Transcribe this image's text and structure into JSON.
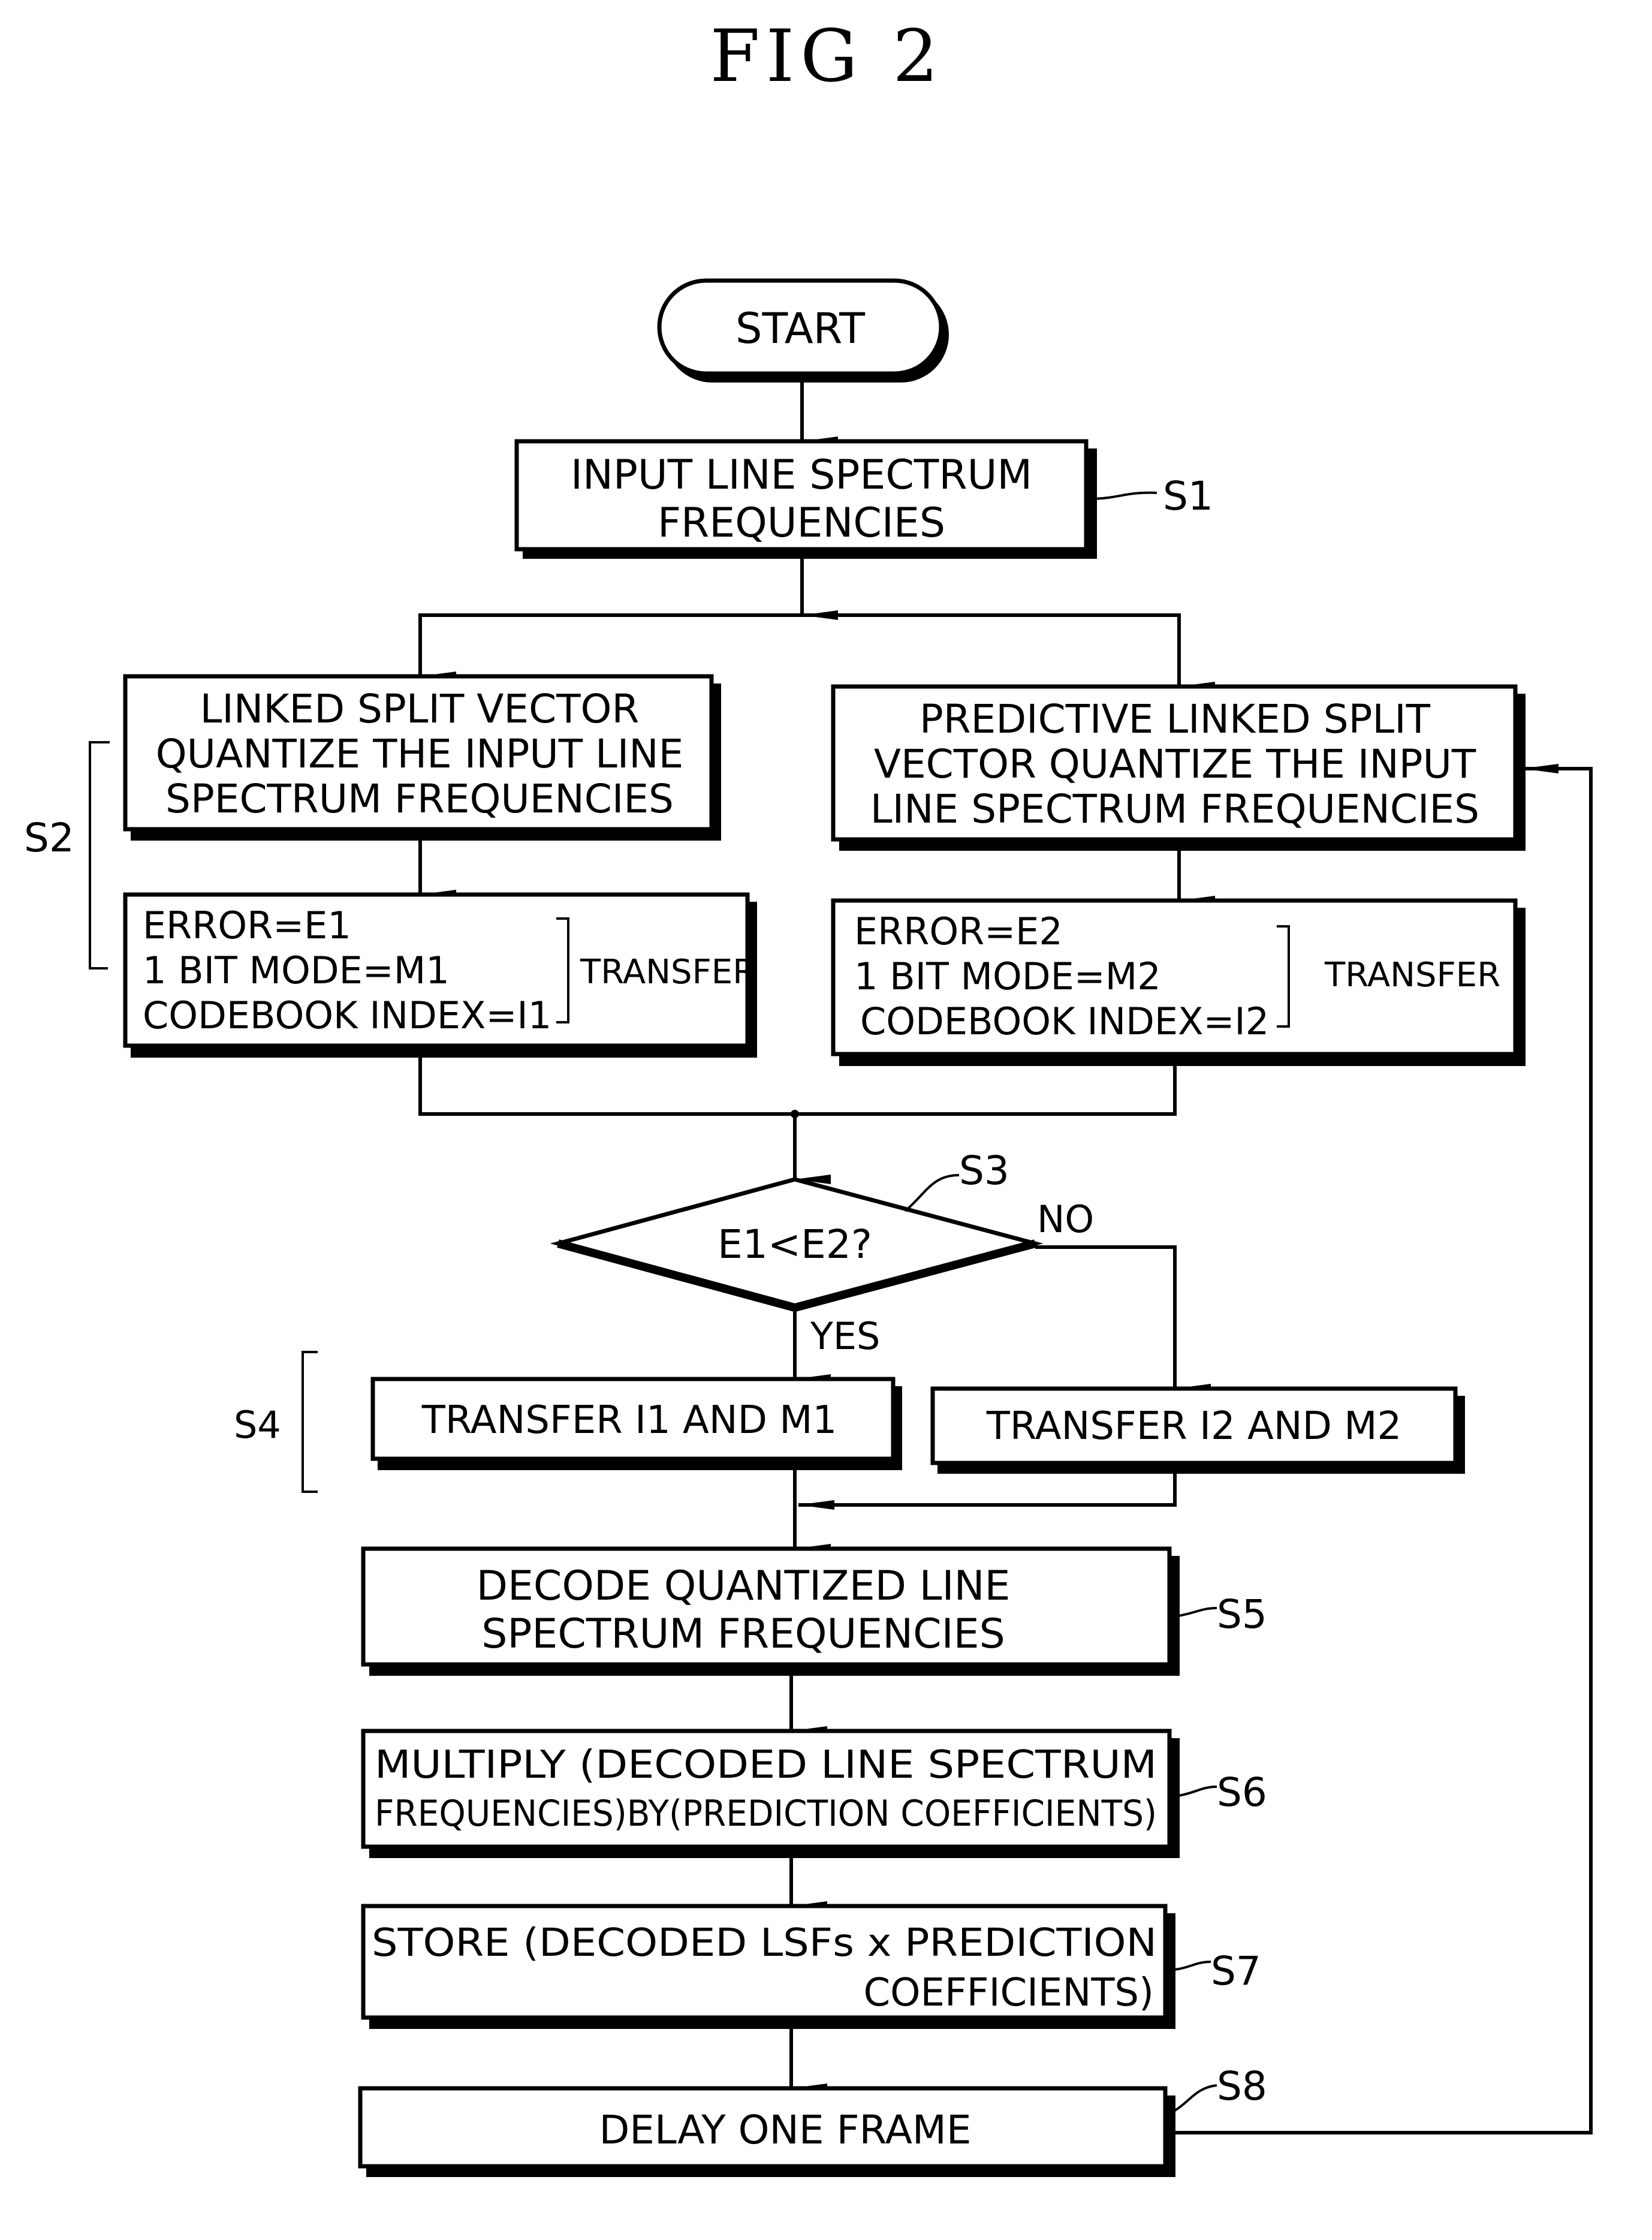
{
  "figure": {
    "title": "FIG 2"
  },
  "flowchart": {
    "start": {
      "label": "START"
    },
    "steps": {
      "s1": {
        "ref": "S1",
        "lines": [
          "INPUT LINE SPECTRUM",
          "FREQUENCIES"
        ]
      },
      "s2": {
        "ref": "S2",
        "left_quantize": {
          "lines": [
            "LINKED SPLIT VECTOR",
            "QUANTIZE THE INPUT LINE",
            "SPECTRUM FREQUENCIES"
          ]
        },
        "right_quantize": {
          "lines": [
            "PREDICTIVE LINKED SPLIT",
            "VECTOR QUANTIZE THE INPUT",
            "LINE SPECTRUM FREQUENCIES"
          ]
        },
        "left_result": {
          "lines": [
            "ERROR=E1",
            "1 BIT MODE=M1",
            "CODEBOOK INDEX=I1"
          ],
          "transfer_label": "TRANSFER"
        },
        "right_result": {
          "lines": [
            "ERROR=E2",
            "1 BIT MODE=M2",
            "CODEBOOK INDEX=I2"
          ],
          "transfer_label": "TRANSFER"
        }
      },
      "s3": {
        "ref": "S3",
        "question": "E1<E2?",
        "yes_label": "YES",
        "no_label": "NO"
      },
      "s4": {
        "ref": "S4",
        "yes_action": "TRANSFER I1 AND M1",
        "no_action": "TRANSFER I2 AND M2"
      },
      "s5": {
        "ref": "S5",
        "lines": [
          "DECODE QUANTIZED LINE",
          "SPECTRUM FREQUENCIES"
        ]
      },
      "s6": {
        "ref": "S6",
        "lines": [
          "MULTIPLY (DECODED LINE SPECTRUM",
          "FREQUENCIES)BY(PREDICTION COEFFICIENTS)"
        ]
      },
      "s7": {
        "ref": "S7",
        "lines": [
          "STORE (DECODED LSFs x PREDICTION",
          "COEFFICIENTS)"
        ]
      },
      "s8": {
        "ref": "S8",
        "lines": [
          "DELAY ONE FRAME"
        ]
      }
    }
  }
}
